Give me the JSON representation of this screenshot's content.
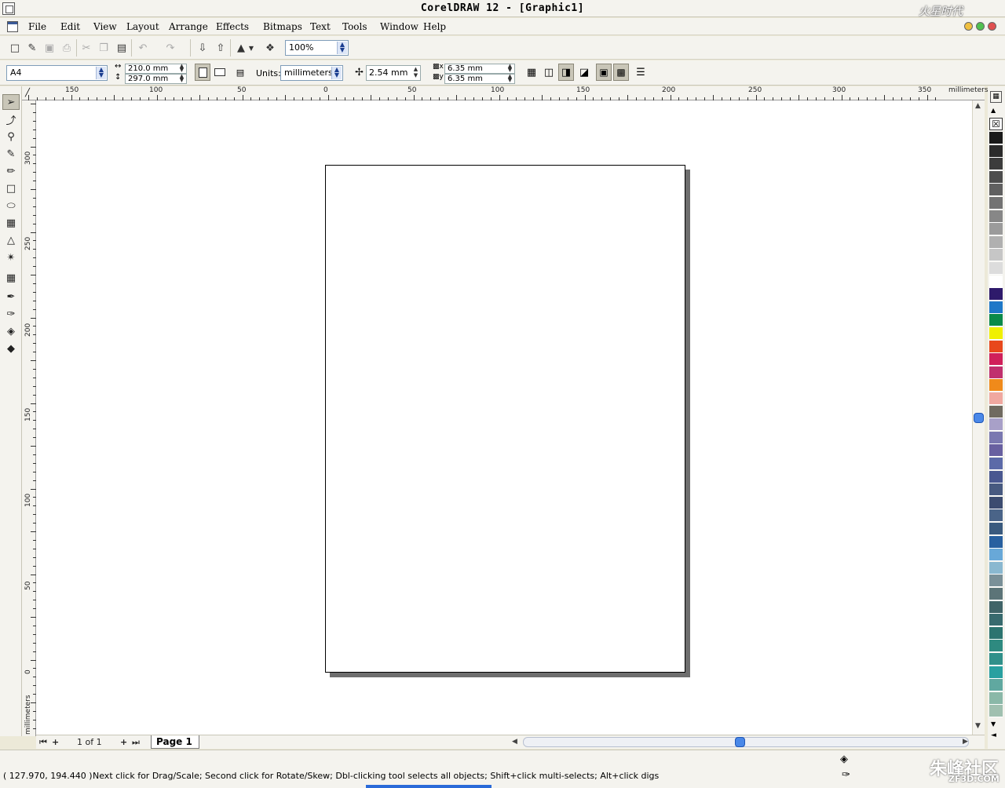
{
  "window": {
    "title": "CorelDRAW 12 - [Graphic1]",
    "watermark_text": "火星时代"
  },
  "menu": {
    "items": [
      "File",
      "Edit",
      "View",
      "Layout",
      "Arrange",
      "Effects",
      "Bitmaps",
      "Text",
      "Tools",
      "Window",
      "Help"
    ]
  },
  "standard_toolbar": {
    "zoom_level": "100%",
    "icons": [
      "new-icon",
      "open-icon",
      "save-icon",
      "print-icon",
      "cut-icon",
      "copy-icon",
      "paste-icon",
      "undo-icon",
      "redo-icon",
      "import-icon",
      "export-icon",
      "application-launcher-icon",
      "corel-online-icon"
    ]
  },
  "property_bar": {
    "paper_type": "A4",
    "paper_width": "210.0 mm",
    "paper_height": "297.0 mm",
    "units_label": "Units:",
    "units_value": "millimeters",
    "nudge_distance": "2.54 mm",
    "duplicate_x": "6.35 mm",
    "duplicate_y": "6.35 mm",
    "duplicate_x_label": "x",
    "duplicate_y_label": "y"
  },
  "rulers": {
    "unit_label": "millimeters",
    "horizontal_ticks": [
      "150",
      "100",
      "50",
      "0",
      "50",
      "100",
      "150",
      "200",
      "250",
      "300",
      "350"
    ],
    "vertical_ticks": [
      "300",
      "250",
      "200",
      "150",
      "100",
      "50",
      "0"
    ],
    "vertical_unit_label": "millimeters"
  },
  "toolbox": {
    "tools": [
      "pick-tool",
      "shape-tool",
      "zoom-tool",
      "freehand-tool",
      "smart-drawing-tool",
      "rectangle-tool",
      "ellipse-tool",
      "graph-paper-tool",
      "basic-shapes-tool",
      "text-tool",
      "interactive-blend-tool",
      "eyedropper-tool",
      "outline-tool",
      "fill-tool",
      "interactive-fill-tool"
    ]
  },
  "page_nav": {
    "page_count": "1 of 1",
    "page_tab": "Page 1"
  },
  "status": {
    "coordinates": "( 127.970, 194.440 )",
    "message": "Next click for Drag/Scale; Second click for Rotate/Skew; Dbl-clicking tool selects all objects; Shift+click multi-selects; Alt+click digs",
    "brand_big": "朱峰社区",
    "brand_small": "ZF3D.COM"
  },
  "palette": {
    "colors": [
      "#1a1a1a",
      "#2b2b2b",
      "#3c3c3c",
      "#4d4d4d",
      "#606060",
      "#737373",
      "#878787",
      "#9b9b9b",
      "#b0b0b0",
      "#c6c6c6",
      "#dcdcdc",
      "#ffffff",
      "#2e1a6b",
      "#1e78c8",
      "#0a8a4a",
      "#f0f000",
      "#e8481c",
      "#d0205a",
      "#c0306e",
      "#f08a1a",
      "#f0a8a0",
      "#706a60",
      "#a8a0c8",
      "#7a78b0",
      "#6860a0",
      "#5c6aa8",
      "#4a5890",
      "#485a80",
      "#3c4c70",
      "#4a6488",
      "#3a5a7e",
      "#2860a0",
      "#68a8d8",
      "#8ab8d0",
      "#7a9098",
      "#5c7478",
      "#406468",
      "#386a6e",
      "#2c7470",
      "#2e8a80",
      "#30908a",
      "#28a0a0",
      "#60a8a0",
      "#8ab8a8",
      "#a0c0b0"
    ]
  }
}
